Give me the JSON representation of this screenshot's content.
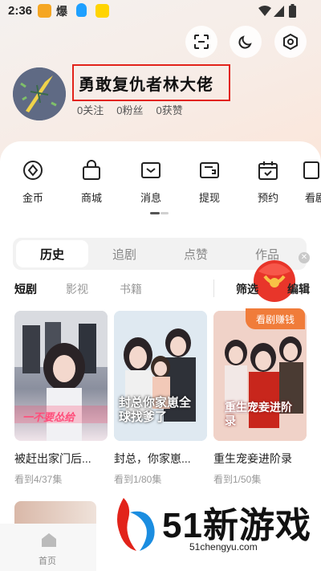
{
  "status_bar": {
    "time": "2:36"
  },
  "profile": {
    "name": "勇敢复仇者林大佬",
    "stats": {
      "follow": "0关注",
      "fans": "0粉丝",
      "likes": "0获赞"
    }
  },
  "quick_actions": [
    {
      "label": "金币",
      "icon": "coin-icon"
    },
    {
      "label": "商城",
      "icon": "shopping-bag-icon"
    },
    {
      "label": "消息",
      "icon": "message-icon"
    },
    {
      "label": "提现",
      "icon": "wallet-icon"
    },
    {
      "label": "预约",
      "icon": "calendar-icon"
    },
    {
      "label": "看剧",
      "icon": "play-icon"
    }
  ],
  "tabs": [
    "历史",
    "追剧",
    "点赞",
    "作品"
  ],
  "filters": {
    "items": [
      "短剧",
      "影视",
      "书籍"
    ],
    "right": "筛选",
    "edit": "编辑"
  },
  "dramas": [
    {
      "title": "被赶出家门后...",
      "sub": "看到4/37集",
      "poster_text": "一不要怂给"
    },
    {
      "title": "封总，你家崽...",
      "sub": "看到1/80集",
      "poster_text": "封总你家崽全球找爹了"
    },
    {
      "title": "重生宠妾进阶录",
      "sub": "看到1/50集",
      "poster_text": "重生宠妾进阶录",
      "badge": "看剧赚钱"
    }
  ],
  "bottom_nav": {
    "home": "首页"
  },
  "watermark": {
    "brand": "51新游戏",
    "url": "51chengyu.com"
  },
  "colors": {
    "highlight_box": "#e2231a",
    "accent_orange": "#f07c3a",
    "brand_red": "#e2231a",
    "brand_blue": "#1b8de0"
  }
}
